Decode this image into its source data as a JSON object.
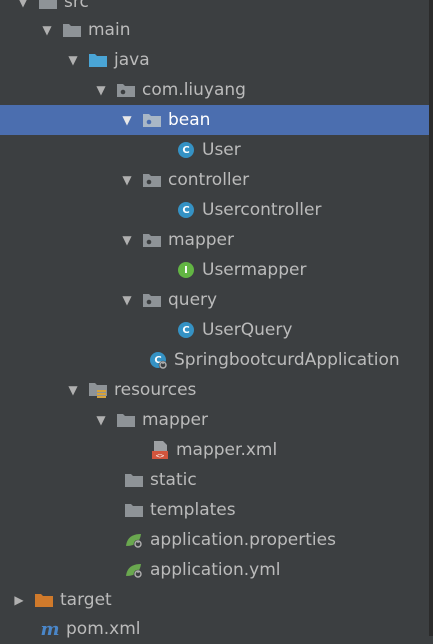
{
  "colors": {
    "background": "#3c3f41",
    "selection": "#4b6eaf",
    "folder": "#8e9397",
    "source_folder": "#4aa5d6",
    "target_folder": "#d07a2b",
    "class_badge": "#3592c4",
    "interface_badge": "#62b543",
    "spring": "#6aa84f"
  },
  "tree": [
    {
      "label": "src",
      "icon": "folder-icon",
      "arrow": "expanded"
    },
    {
      "label": "main",
      "icon": "folder-icon",
      "arrow": "expanded"
    },
    {
      "label": "java",
      "icon": "source-folder-icon",
      "arrow": "expanded"
    },
    {
      "label": "com.liuyang",
      "icon": "package-icon",
      "arrow": "expanded"
    },
    {
      "label": "bean",
      "icon": "package-icon",
      "arrow": "expanded",
      "selected": true
    },
    {
      "label": "User",
      "icon": "class-icon",
      "badge": "C"
    },
    {
      "label": "controller",
      "icon": "package-icon",
      "arrow": "expanded"
    },
    {
      "label": "Usercontroller",
      "icon": "class-icon",
      "badge": "C"
    },
    {
      "label": "mapper",
      "icon": "package-icon",
      "arrow": "expanded"
    },
    {
      "label": "Usermapper",
      "icon": "interface-icon",
      "badge": "I"
    },
    {
      "label": "query",
      "icon": "package-icon",
      "arrow": "expanded"
    },
    {
      "label": "UserQuery",
      "icon": "class-icon",
      "badge": "C"
    },
    {
      "label": "SpringbootcurdApplication",
      "icon": "spring-boot-class-icon",
      "badge": "C"
    },
    {
      "label": "resources",
      "icon": "resources-folder-icon",
      "arrow": "expanded"
    },
    {
      "label": "mapper",
      "icon": "folder-icon",
      "arrow": "expanded"
    },
    {
      "label": "mapper.xml",
      "icon": "xml-file-icon"
    },
    {
      "label": "static",
      "icon": "folder-icon"
    },
    {
      "label": "templates",
      "icon": "folder-icon"
    },
    {
      "label": "application.properties",
      "icon": "spring-config-icon"
    },
    {
      "label": "application.yml",
      "icon": "spring-config-icon"
    },
    {
      "label": "target",
      "icon": "excluded-folder-icon",
      "arrow": "collapsed"
    },
    {
      "label": "pom.xml",
      "icon": "maven-icon"
    }
  ]
}
